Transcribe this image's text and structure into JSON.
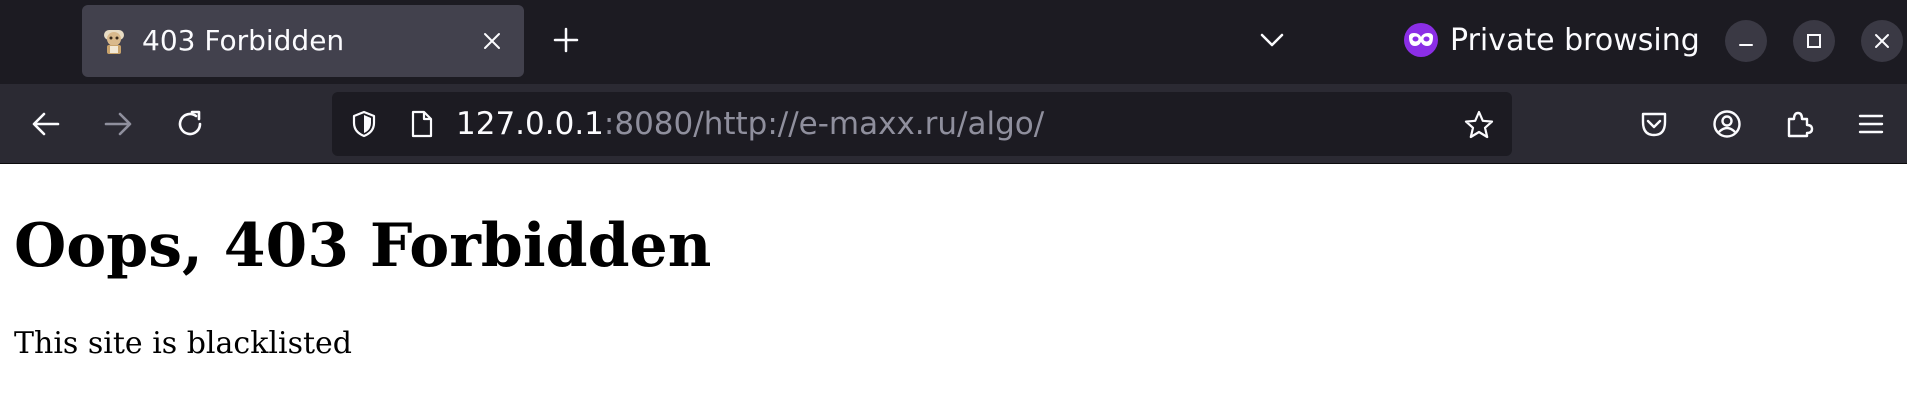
{
  "browser": {
    "tab": {
      "title": "403 Forbidden",
      "favicon": "mascot-favicon-icon",
      "close_icon": "close-icon"
    },
    "new_tab_icon": "plus-icon",
    "tab_list_icon": "chevron-down-icon",
    "private_mode": {
      "label": "Private browsing",
      "icon": "private-mask-icon",
      "color": "#8b2ee6"
    },
    "window_controls": {
      "minimize_icon": "minimize-icon",
      "maximize_icon": "maximize-icon",
      "close_icon": "close-icon"
    }
  },
  "toolbar": {
    "back_icon": "arrow-left-icon",
    "forward_icon": "arrow-right-icon",
    "reload_icon": "reload-icon",
    "url": {
      "host": "127.0.0.1",
      "rest": ":8080/http://e-maxx.ru/algo/"
    },
    "bookmark_icon": "star-icon",
    "pocket_icon": "pocket-icon",
    "account_icon": "account-icon",
    "extensions_icon": "puzzle-icon",
    "menu_icon": "hamburger-menu-icon"
  },
  "page": {
    "heading": "Oops, 403 Forbidden",
    "message": "This site is blacklisted"
  },
  "colors": {
    "tabstrip_bg": "#1c1b22",
    "active_tab_bg": "#42414d",
    "toolbar_bg": "#2b2a33",
    "urlbar_bg": "#1c1b22",
    "url_dim_text": "#8f8f9d"
  }
}
